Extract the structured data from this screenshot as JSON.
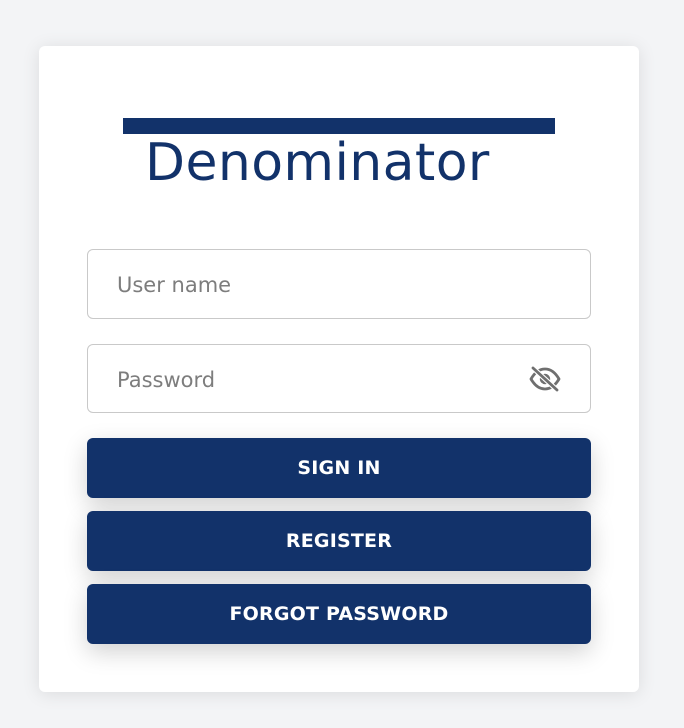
{
  "brand": {
    "name": "Denominator",
    "color": "#12326a"
  },
  "form": {
    "username_placeholder": "User name",
    "username_value": "",
    "password_placeholder": "Password",
    "password_value": "",
    "password_toggle_icon": "eye-slash-icon"
  },
  "actions": {
    "sign_in_label": "SIGN IN",
    "register_label": "REGISTER",
    "forgot_password_label": "FORGOT PASSWORD"
  },
  "colors": {
    "background": "#f3f4f6",
    "card": "#ffffff",
    "primary": "#12326a",
    "input_border": "#c9c9c9",
    "placeholder": "#7d7d7d"
  }
}
